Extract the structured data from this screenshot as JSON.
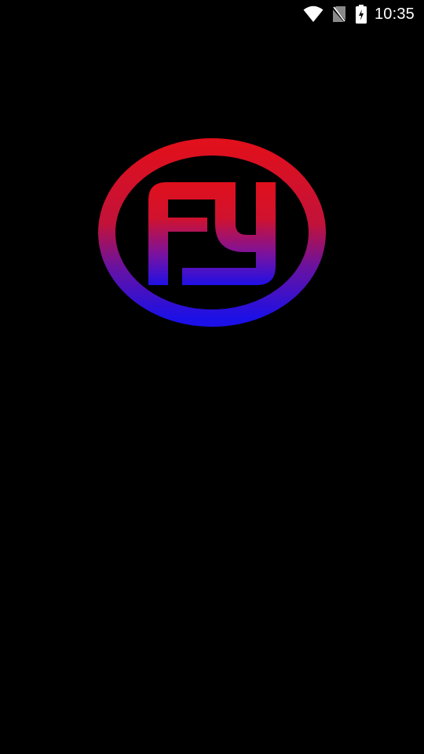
{
  "status_bar": {
    "time": "10:35",
    "icons": [
      "wifi-icon",
      "no-sim-icon",
      "battery-charging-icon"
    ]
  },
  "splash": {
    "logo_icon": "fy-logo-icon",
    "colors": {
      "background": "#000000",
      "gradient_top": "#e0101c",
      "gradient_bottom": "#1c10e6"
    }
  }
}
